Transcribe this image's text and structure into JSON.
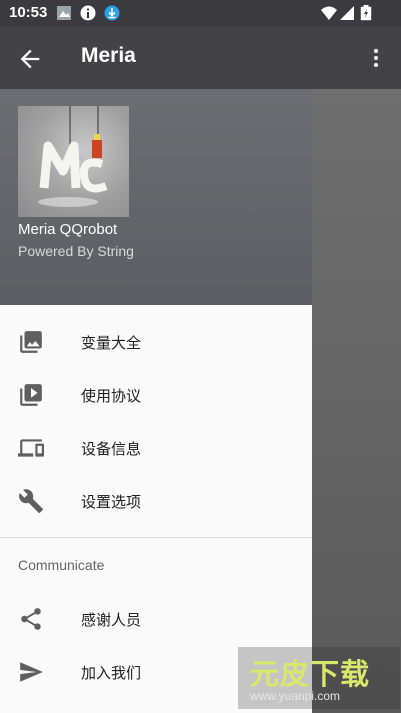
{
  "status_bar": {
    "time": "10:53"
  },
  "app_bar": {
    "title": "Meria"
  },
  "drawer": {
    "header": {
      "name": "Meria QQrobot",
      "subtitle": "Powered By String"
    },
    "items": [
      {
        "label": "变量大全",
        "icon": "photo-library-icon"
      },
      {
        "label": "使用协议",
        "icon": "video-library-icon"
      },
      {
        "label": "设备信息",
        "icon": "devices-icon"
      },
      {
        "label": "设置选项",
        "icon": "wrench-icon"
      }
    ],
    "section_title": "Communicate",
    "section_items": [
      {
        "label": "感谢人员",
        "icon": "share-icon"
      },
      {
        "label": "加入我们",
        "icon": "send-icon"
      }
    ]
  },
  "watermark": {
    "logo": "元皮下载",
    "url": "www.yuanpi.com"
  },
  "colors": {
    "app_bar": "#434347",
    "status_bar": "#3b3b3f",
    "drawer_bg": "#fafafa",
    "icon": "#5f5f5f"
  }
}
